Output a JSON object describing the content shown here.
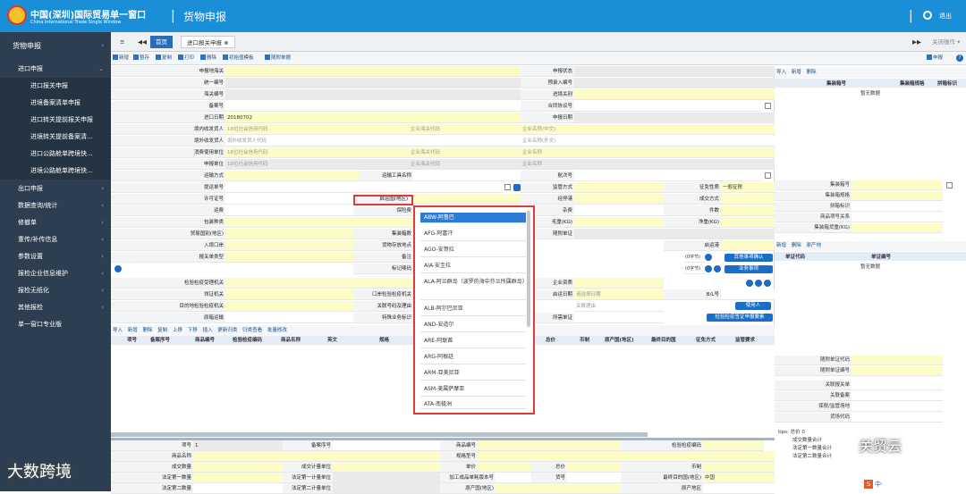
{
  "header": {
    "brand_cn": "中国(深圳)国际贸易单一窗口",
    "brand_en": "China International Trade Single Window",
    "separator": "|",
    "title": "货物申报",
    "exit_label": "退出"
  },
  "sidebar": {
    "top_label": "货物申报",
    "import_label": "进口申报",
    "import_items": [
      "进口报关申报",
      "进境备案清单申报",
      "进口转关提前报关申报",
      "进境转关提前备案清...",
      "进口公路舱单跨境快...",
      "进境公路舱单跨境快..."
    ],
    "groups": [
      "出口申报",
      "数据查询/统计",
      "修撤单",
      "重传/补传信息",
      "参数设置",
      "报检企业信息维护",
      "报检无纸化",
      "其他报检"
    ],
    "bottom_label": "单一窗口专业版"
  },
  "tabs": {
    "nav_left": "≡",
    "nav_back": "◀◀",
    "home": "首页",
    "current": "进口报关申报",
    "close": "⊗",
    "nav_fwd": "▶▶",
    "close_ops": "关闭操作 ▾"
  },
  "toolbar": {
    "buttons": [
      "新增",
      "暂存",
      "复制",
      "打印",
      "删除",
      "初始值模板",
      "随附单据"
    ],
    "declare": "申报",
    "help": "?"
  },
  "form": {
    "labels": {
      "declare_customs": "申报地海关",
      "declare_status": "申报状态",
      "unified_no": "统一编号",
      "pre_entry_no": "预录入编号",
      "customs_no": "海关编号",
      "entry_customs": "进境关别",
      "record_no": "备案号",
      "contract_no": "合同协议号",
      "import_date": "进口日期",
      "declare_date": "申报日期",
      "consignee": "境内收发货人",
      "overseas_consignor": "境外收发货人",
      "consumer_unit": "消费使用单位",
      "declarant": "申报单位",
      "transport_mode": "运输方式",
      "transport_name": "运输工具名称",
      "voyage_no": "航次号",
      "bl_no": "提运单号",
      "supervision_mode": "监管方式",
      "exemption": "征免性质",
      "license_no": "许可证号",
      "origin_country": "启运国(地区)",
      "port_stop": "经停港",
      "deal_mode": "成交方式",
      "freight": "运费",
      "insurance": "保险费",
      "misc_fee": "杂费",
      "pieces": "件数",
      "packing": "包装种类",
      "gross_weight": "毛重(KG)",
      "net_weight": "净重(KG)",
      "trade_country": "贸易国别(地区)",
      "container_count": "集装箱数",
      "attached_docs": "随附单证",
      "entry_port": "入境口岸",
      "goods_location": "货物存放地点",
      "origin_port": "启运港",
      "declare_type": "报关单类型",
      "remarks": "备注",
      "mark_no": "标记唛码",
      "inspection_authority": "检验检疫受理机关",
      "enterprise_qual": "企业资质",
      "collar_authority": "领证机关",
      "port_inspection": "口岸检验检疫机关",
      "start_date": "启运日期",
      "bl_short": "B/L号",
      "dest_authority": "目的地检验检疫机关",
      "related_no_reason": "关联号码及理由",
      "related_reason": "关联理由",
      "original_state": "原箱运输",
      "special_business": "特殊业务标识",
      "doc_no": "所需单证"
    },
    "values": {
      "import_date": "20180702",
      "credit_code": "18位社会信用代码",
      "overseas_code": "境外收发货人代码",
      "customs_code": "企业海关代码",
      "name_cn": "企业名称(中文)",
      "name_foreign": "企业名称(外文)",
      "name": "企业名称",
      "exemption": "一般征税",
      "start_date_ph": "请选择日期",
      "related_reason_ph": "关联理由",
      "chars_left": "(0字节)"
    },
    "buttons": {
      "other_items": "其他事项确认",
      "business_items": "业务事项",
      "user": "使用人",
      "inspection_sign": "检验检疫签证申报要素"
    }
  },
  "dropdown": {
    "options": [
      "ABW-阿鲁巴",
      "AFG-阿富汗",
      "AGO-安哥拉",
      "AIA-安圭拉",
      "ALA-阿兰群岛（波罗的海中芬兰所属群岛）",
      "ALB-阿尔巴尼亚",
      "AND-安道尔",
      "ARE-阿联酋",
      "ARG-阿根廷",
      "ARM-亚美尼亚",
      "ASM-美属萨摩亚",
      "ATA-南极洲"
    ]
  },
  "grid": {
    "toolbar": [
      "导入",
      "新增",
      "删除",
      "复制",
      "上移",
      "下移",
      "插入",
      "更新归类",
      "归类查看",
      "批量修改"
    ],
    "columns": [
      "项号",
      "备案序号",
      "商品编号",
      "检验检疫编码",
      "商品名称",
      "英文",
      "规格",
      "总价",
      "币制",
      "原产国(地区)",
      "最终目的国",
      "征免方式",
      "监管要求"
    ]
  },
  "bottom": {
    "labels": [
      "项号",
      "备案序号",
      "商品编号",
      "检验检疫编码",
      "商品名称",
      "规格型号",
      "成交数量",
      "成交计量单位",
      "单价",
      "总价",
      "币制",
      "法定第一数量",
      "法定第一计量单位",
      "加工成品单耗版本号",
      "货号",
      "最终目的国(地区)",
      "法定第二数量",
      "法定第二计量单位",
      "原产国(地区)",
      "原产地区"
    ],
    "item_no": "1",
    "dest_value": "中国"
  },
  "right_panel": {
    "toolbar_top": [
      "导入",
      "新增",
      "删除"
    ],
    "columns_top": [
      "集装箱号",
      "集装箱规格",
      "拼箱标识"
    ],
    "no_data": "暂无数据",
    "fields_top": [
      "集装箱号",
      "集装箱规格",
      "拼箱标识",
      "商品项号关系",
      "集装箱货重(KG)"
    ],
    "toolbar_mid": [
      "新增",
      "删除",
      "原产地"
    ],
    "columns_mid": [
      "单证代码",
      "单证编号"
    ],
    "fields_bottom": [
      "随附单证代码",
      "随附单证编号",
      "关联报关单",
      "关联备案",
      "保税/监管场地",
      "货场代码"
    ],
    "tips": "tips: 总价 0",
    "tips_rows": [
      "成交数量合计",
      "法定第一数量合计",
      "法定第二数量合计"
    ]
  },
  "watermarks": {
    "left": "大数跨境",
    "right": "关贸云"
  },
  "tray": {
    "label": "中·"
  }
}
